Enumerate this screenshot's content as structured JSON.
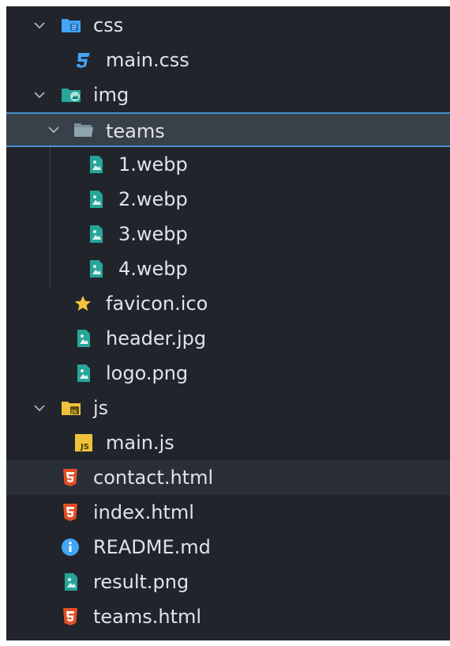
{
  "tree": {
    "items": [
      {
        "label": "css",
        "kind": "folder",
        "icon": "css-folder-icon",
        "expanded": true
      },
      {
        "label": "main.css",
        "kind": "file",
        "icon": "css-file-icon"
      },
      {
        "label": "img",
        "kind": "folder",
        "icon": "image-folder-icon",
        "expanded": true
      },
      {
        "label": "teams",
        "kind": "folder",
        "icon": "folder-icon",
        "expanded": true,
        "selected": true
      },
      {
        "label": "1.webp",
        "kind": "file",
        "icon": "image-file-icon"
      },
      {
        "label": "2.webp",
        "kind": "file",
        "icon": "image-file-icon"
      },
      {
        "label": "3.webp",
        "kind": "file",
        "icon": "image-file-icon"
      },
      {
        "label": "4.webp",
        "kind": "file",
        "icon": "image-file-icon"
      },
      {
        "label": "favicon.ico",
        "kind": "file",
        "icon": "star-icon"
      },
      {
        "label": "header.jpg",
        "kind": "file",
        "icon": "image-file-icon"
      },
      {
        "label": "logo.png",
        "kind": "file",
        "icon": "image-file-icon"
      },
      {
        "label": "js",
        "kind": "folder",
        "icon": "js-folder-icon",
        "expanded": true
      },
      {
        "label": "main.js",
        "kind": "file",
        "icon": "js-file-icon"
      },
      {
        "label": "contact.html",
        "kind": "file",
        "icon": "html5-icon",
        "hovered": true
      },
      {
        "label": "index.html",
        "kind": "file",
        "icon": "html5-icon"
      },
      {
        "label": "README.md",
        "kind": "file",
        "icon": "info-icon"
      },
      {
        "label": "result.png",
        "kind": "file",
        "icon": "image-file-icon"
      },
      {
        "label": "teams.html",
        "kind": "file",
        "icon": "html5-icon"
      }
    ]
  },
  "colors": {
    "background": "#21252b",
    "text": "#dfe3ea",
    "selection": "#394049",
    "selection_border": "#4a8fd0",
    "css_blue": "#42a5f5",
    "image_teal": "#26a69a",
    "js_yellow": "#f0c23b",
    "html_red": "#e44d26",
    "folder_gray": "#90a4ae",
    "star_yellow": "#f7c33c",
    "info_blue": "#42a5f5"
  }
}
